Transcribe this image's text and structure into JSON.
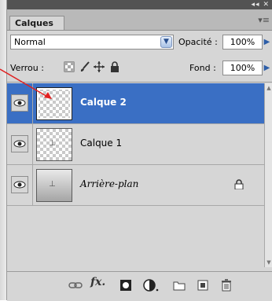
{
  "panel": {
    "tab_label": "Calques",
    "collapse_glyph": "◂◂",
    "close_glyph": "✕",
    "menu_glyph": "▾≡"
  },
  "blend": {
    "mode": "Normal",
    "opacity_label": "Opacité :",
    "opacity_value": "100%",
    "lock_label": "Verrou :",
    "fill_label": "Fond :",
    "fill_value": "100%"
  },
  "layers": [
    {
      "name": "Calque 2",
      "selected": true,
      "visible": true
    },
    {
      "name": "Calque 1",
      "selected": false,
      "visible": true
    },
    {
      "name": "Arrière-plan",
      "selected": false,
      "visible": true,
      "locked": true
    }
  ],
  "bottom_toolbar": {
    "fx_label": "fx."
  },
  "colors": {
    "selection": "#3a6fc4",
    "panel_bg": "#d6d6d6",
    "titlebar": "#535353",
    "annotation_arrow": "#e02020"
  },
  "icons": [
    "eye-icon",
    "lock-icon",
    "link-icon",
    "fx-icon",
    "mask-icon",
    "adjustment-icon",
    "folder-icon",
    "new-layer-icon",
    "trash-icon",
    "lock-transparency-icon",
    "brush-icon",
    "move-icon"
  ]
}
